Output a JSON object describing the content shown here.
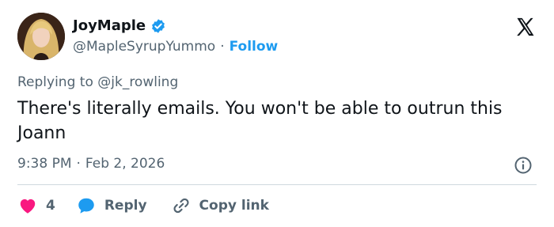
{
  "author": {
    "display_name": "JoyMaple",
    "handle": "@MapleSyrupYummo",
    "separator": "·",
    "follow_label": "Follow",
    "verified": true,
    "verified_color": "#1d9bf0"
  },
  "reply_context": {
    "prefix": "Replying to",
    "mention": "@jk_rowling"
  },
  "tweet": {
    "text": "There's literally emails. You won't be able to outrun this Joann",
    "time": "9:38 PM",
    "separator": "·",
    "date": "Feb 2, 2026"
  },
  "actions": {
    "like_count": "4",
    "like_color": "#f91880",
    "reply_label": "Reply",
    "reply_color": "#1d9bf0",
    "copy_label": "Copy link"
  },
  "icons": {
    "brand": "x-logo-icon",
    "verified": "verified-badge-icon",
    "info": "info-icon",
    "like": "heart-icon",
    "reply": "speech-bubble-icon",
    "copy": "link-icon"
  }
}
